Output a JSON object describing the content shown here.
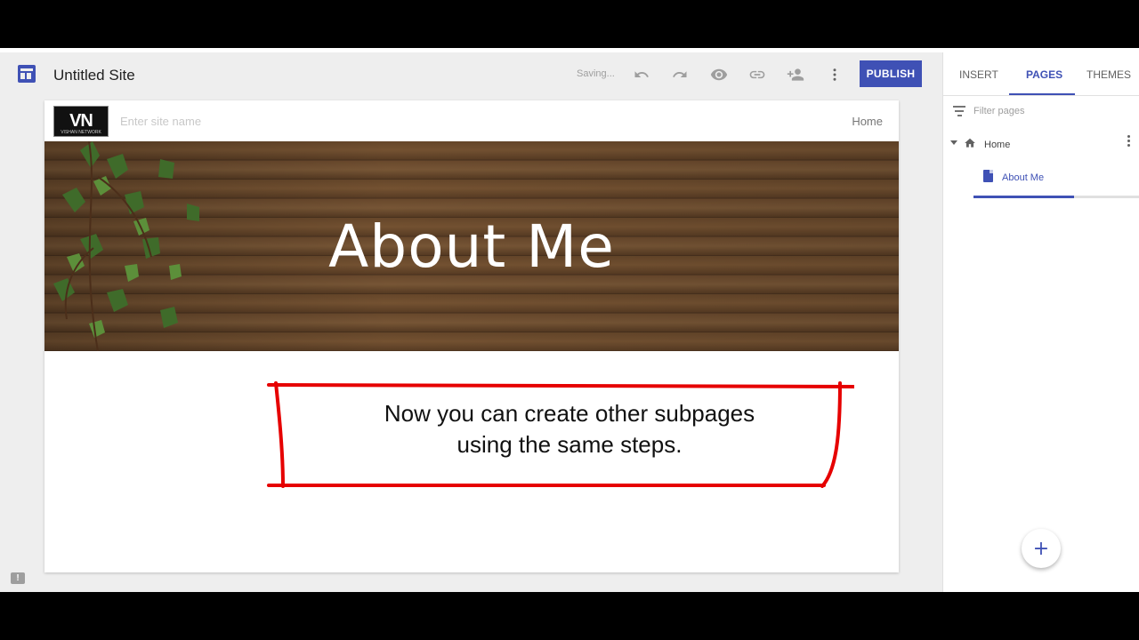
{
  "app": {
    "title": "Untitled Site",
    "status": "Saving...",
    "publish_label": "PUBLISH",
    "toolbar_icons": [
      "undo-icon",
      "redo-icon",
      "preview-icon",
      "link-icon",
      "share-icon",
      "more-icon"
    ]
  },
  "site": {
    "logo_text": "VN",
    "logo_subtext": "VISHAN NETWORK",
    "name_placeholder": "Enter site name",
    "nav_home": "Home",
    "hero_title": "About Me"
  },
  "callout": {
    "line1": "Now you can create other subpages",
    "line2": "using the same steps.",
    "border_color": "#e60000"
  },
  "sidebar": {
    "tabs": [
      {
        "label": "INSERT",
        "active": false
      },
      {
        "label": "PAGES",
        "active": true
      },
      {
        "label": "THEMES",
        "active": false
      }
    ],
    "filter_placeholder": "Filter pages",
    "pages": [
      {
        "label": "Home",
        "icon": "home-icon"
      },
      {
        "label": "About Me",
        "icon": "page-icon",
        "selected": true
      }
    ],
    "fab_label": "+"
  },
  "colors": {
    "accent": "#3f51b5",
    "background": "#eeeeee"
  }
}
